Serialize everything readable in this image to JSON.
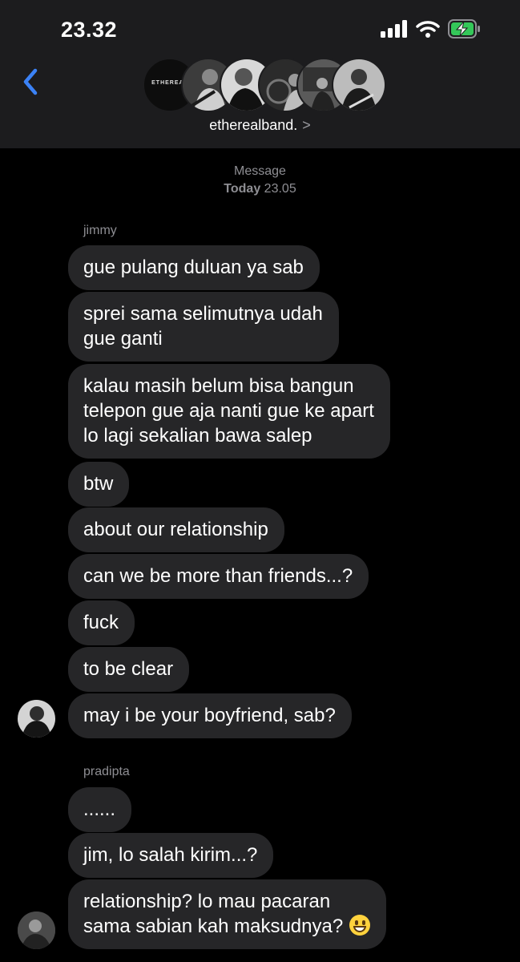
{
  "status_bar": {
    "time": "23.32",
    "battery_color": "#34c759"
  },
  "header": {
    "back_icon": "chevron-left-icon",
    "back_color": "#3b82f6",
    "group_name": "etherealband.",
    "group_chevron": ">",
    "group_logo_text": "ETHEREAL"
  },
  "system_message": {
    "title": "Message",
    "day": "Today",
    "time": "23.05"
  },
  "thread": {
    "sender1": "jimmy",
    "sender2": "pradipta",
    "m1": "gue pulang duluan ya sab",
    "m2_l1": "sprei sama selimutnya udah",
    "m2_l2": "gue ganti",
    "m3_l1": "kalau masih belum bisa bangun",
    "m3_l2": "telepon gue aja nanti gue ke apart",
    "m3_l3": "lo lagi sekalian bawa salep",
    "m4": "btw",
    "m5": "about our relationship",
    "m6": "can we be more than friends...?",
    "m7": "fuck",
    "m8": "to be clear",
    "m9": "may i be your boyfriend, sab?",
    "m10": "......",
    "m11": "jim, lo salah kirim...?",
    "m12_l1": "relationship? lo mau pacaran",
    "m12_l2": "sama sabian kah maksudnya?",
    "m12_emoji": "grinning-face-emoji"
  }
}
